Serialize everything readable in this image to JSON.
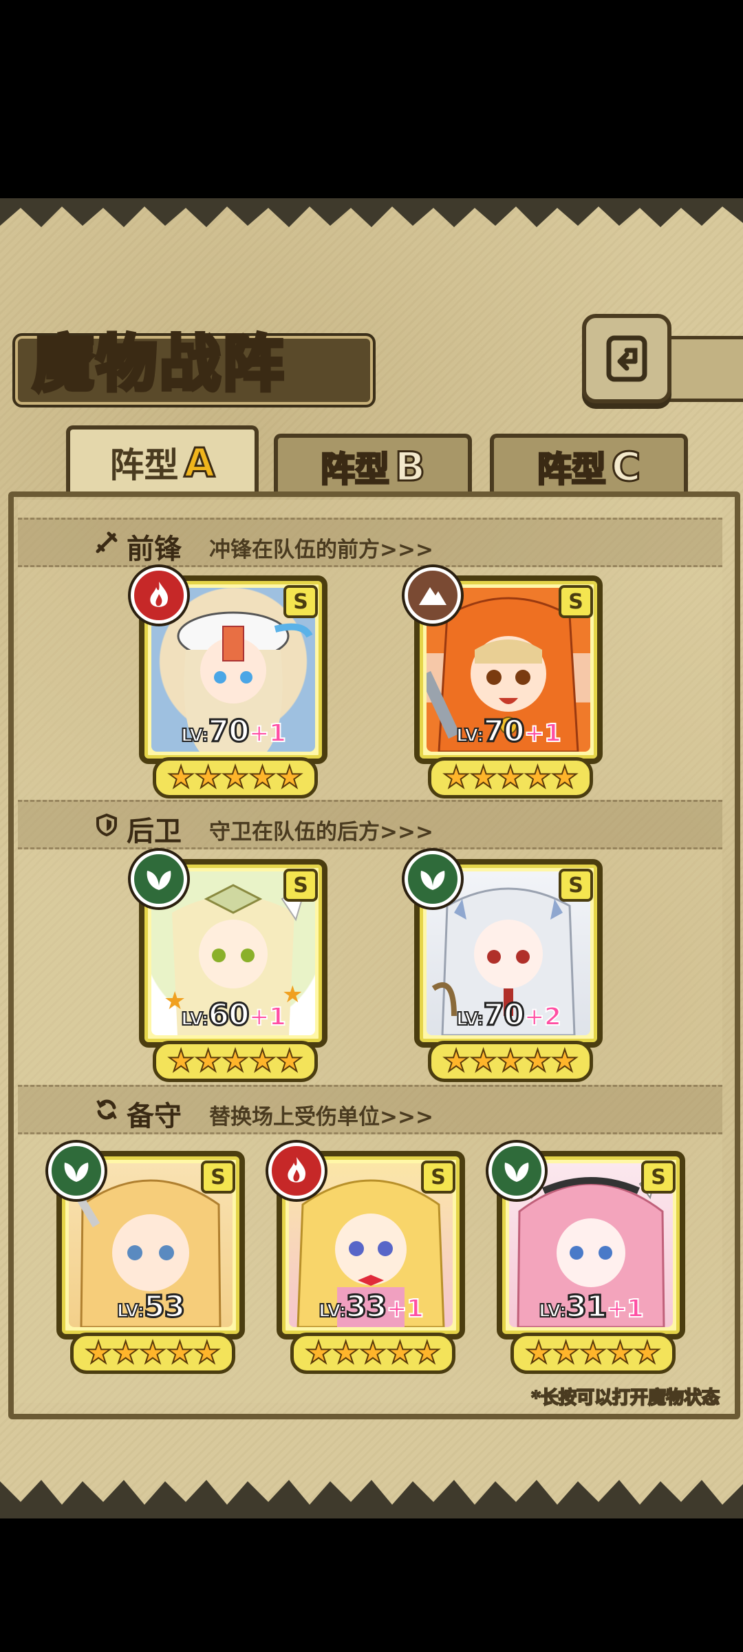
{
  "title": "魔物战阵",
  "tabs": [
    {
      "label": "阵型",
      "letter": "A",
      "active": true
    },
    {
      "label": "阵型",
      "letter": "B",
      "active": false
    },
    {
      "label": "阵型",
      "letter": "C",
      "active": false
    }
  ],
  "sections": {
    "front": {
      "label": "前锋",
      "desc": "冲锋在队伍的前方>>>",
      "icon": "sword-icon"
    },
    "rear": {
      "label": "后卫",
      "desc": "守卫在队伍的后方>>>",
      "icon": "shield-icon"
    },
    "reserve": {
      "label": "备守",
      "desc": "替换场上受伤单位>>>",
      "icon": "swap-icon"
    }
  },
  "cards": [
    {
      "element": "fire",
      "grade": "S",
      "lv": "70",
      "plus": "+1",
      "stars": 5
    },
    {
      "element": "earth",
      "grade": "S",
      "lv": "70",
      "plus": "+1",
      "stars": 5
    },
    {
      "element": "leaf",
      "grade": "S",
      "lv": "60",
      "plus": "+1",
      "stars": 5
    },
    {
      "element": "leaf",
      "grade": "S",
      "lv": "70",
      "plus": "+2",
      "stars": 5
    },
    {
      "element": "leaf",
      "grade": "S",
      "lv": "53",
      "plus": "",
      "stars": 5
    },
    {
      "element": "fire",
      "grade": "S",
      "lv": "33",
      "plus": "+1",
      "stars": 5
    },
    {
      "element": "leaf",
      "grade": "S",
      "lv": "31",
      "plus": "+1",
      "stars": 5
    }
  ],
  "lv_prefix": "LV:",
  "hint": "*长按可以打开魔物状态",
  "colors": {
    "panel": "#d8c99c",
    "frame": "#6b5a34",
    "card_border": "#e5d54a",
    "star": "#ffb52b"
  }
}
